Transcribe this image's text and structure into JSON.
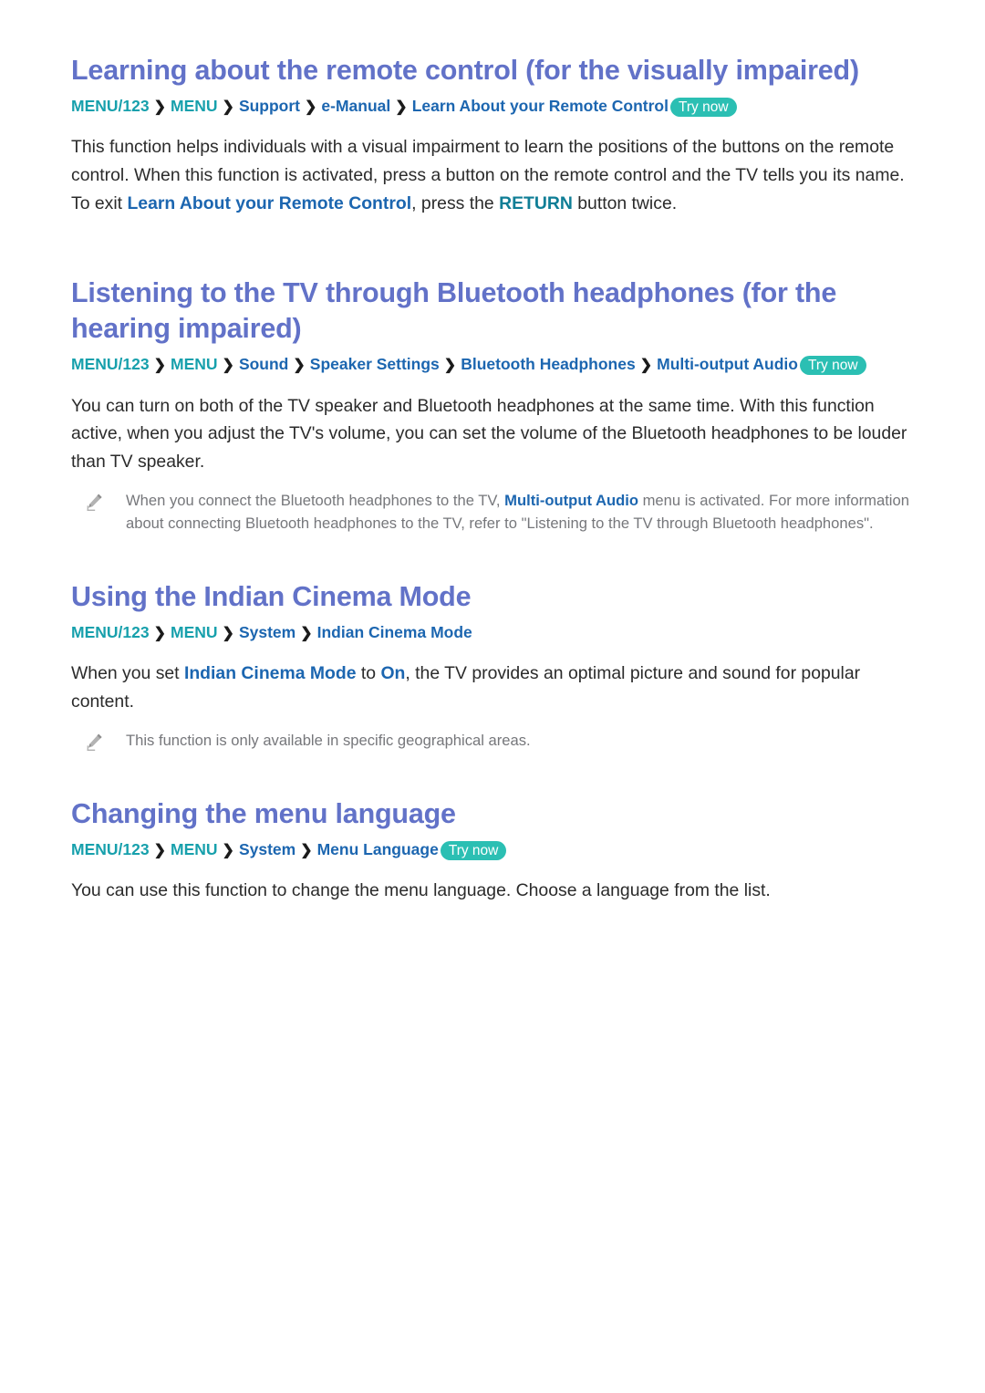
{
  "document": {
    "type": "e-manual-page",
    "background_color": "#ffffff",
    "colors": {
      "heading": "#6272c8",
      "body_text": "#2b2b2b",
      "link_blue": "#1c66b0",
      "link_teal": "#0f7e96",
      "menu_key_teal": "#17a0ac",
      "badge_background": "#2bbfb3",
      "badge_text": "#ffffff",
      "note_text": "#76777b",
      "separator": "#1b1b1b"
    }
  },
  "sections": [
    {
      "id": "learning-remote-control",
      "heading": "Learning about the remote control (for the visually impaired)",
      "path": {
        "nodes": [
          "MENU/123",
          "MENU",
          "Support",
          "e-Manual",
          "Learn About your Remote Control"
        ],
        "separator": "❯",
        "badge": "Try now"
      },
      "paragraphs": [
        {
          "parts": [
            {
              "text": "This function helps individuals with a visual impairment to learn the positions of the buttons on the remote control. When this function is activated, press a button on the remote control and the TV tells you its name. To exit ",
              "style": "plain"
            },
            {
              "text": "Learn About your Remote Control",
              "style": "link"
            },
            {
              "text": ", press the ",
              "style": "plain"
            },
            {
              "text": "RETURN",
              "style": "link-teal"
            },
            {
              "text": " button twice.",
              "style": "plain"
            }
          ]
        }
      ],
      "notes": []
    },
    {
      "id": "bluetooth-headphones",
      "heading": "Listening to the TV through Bluetooth headphones (for the hearing impaired)",
      "path": {
        "nodes": [
          "MENU/123",
          "MENU",
          "Sound",
          "Speaker Settings",
          "Bluetooth Headphones",
          "Multi-output Audio"
        ],
        "separator": "❯",
        "badge": "Try now"
      },
      "paragraphs": [
        {
          "parts": [
            {
              "text": "You can turn on both of the TV speaker and Bluetooth headphones at the same time. With this function active, when you adjust the TV's volume, you can set the volume of the Bluetooth headphones to be louder than TV speaker.",
              "style": "plain"
            }
          ]
        }
      ],
      "notes": [
        {
          "icon": "pencil-icon",
          "parts": [
            {
              "text": "When you connect the Bluetooth headphones to the TV, ",
              "style": "plain"
            },
            {
              "text": "Multi-output Audio",
              "style": "link"
            },
            {
              "text": " menu is activated. For more information about connecting Bluetooth headphones to the TV, refer to \"Listening to the TV through Bluetooth headphones\".",
              "style": "plain"
            }
          ]
        }
      ]
    },
    {
      "id": "indian-cinema-mode",
      "heading": "Using the Indian Cinema Mode",
      "path": {
        "nodes": [
          "MENU/123",
          "MENU",
          "System",
          "Indian Cinema Mode"
        ],
        "separator": "❯",
        "badge": null
      },
      "paragraphs": [
        {
          "parts": [
            {
              "text": "When you set ",
              "style": "plain"
            },
            {
              "text": "Indian Cinema Mode",
              "style": "link"
            },
            {
              "text": " to ",
              "style": "plain"
            },
            {
              "text": "On",
              "style": "link"
            },
            {
              "text": ", the TV provides an optimal picture and sound for popular content.",
              "style": "plain"
            }
          ]
        }
      ],
      "notes": [
        {
          "icon": "pencil-icon",
          "parts": [
            {
              "text": "This function is only available in specific geographical areas.",
              "style": "plain"
            }
          ]
        }
      ]
    },
    {
      "id": "changing-menu-language",
      "heading": "Changing the menu language",
      "path": {
        "nodes": [
          "MENU/123",
          "MENU",
          "System",
          "Menu Language"
        ],
        "separator": "❯",
        "badge": "Try now"
      },
      "paragraphs": [
        {
          "parts": [
            {
              "text": "You can use this function to change the menu language. Choose a language from the list.",
              "style": "plain"
            }
          ]
        }
      ],
      "notes": []
    }
  ]
}
